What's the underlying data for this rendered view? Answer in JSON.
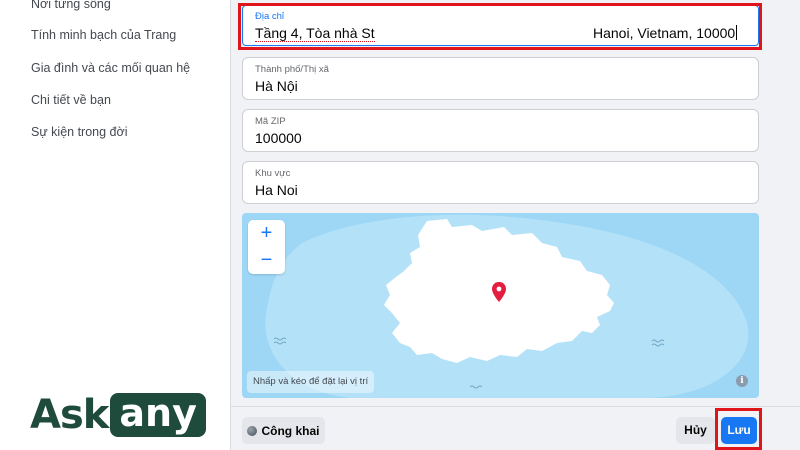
{
  "sidebar": {
    "items": [
      {
        "label": "Nơi từng sống"
      },
      {
        "label": "Tính minh bạch của Trang"
      },
      {
        "label": "Gia đình và các mối quan hệ"
      },
      {
        "label": "Chi tiết về bạn"
      },
      {
        "label": "Sự kiện trong đời"
      }
    ]
  },
  "form": {
    "address": {
      "label": "Địa chỉ",
      "value_start": "Tầng 4, Tòa nhà St",
      "value_end": "Hanoi, Vietnam, 10000"
    },
    "city": {
      "label": "Thành phố/Thị xã",
      "value": "Hà Nội"
    },
    "zip": {
      "label": "Mã ZIP",
      "value": "100000"
    },
    "region": {
      "label": "Khu vực",
      "value": "Ha Noi"
    }
  },
  "map": {
    "zoom_in": "+",
    "zoom_out": "−",
    "hint": "Nhấp và kéo để đặt lại vị trí",
    "info": "i",
    "colors": {
      "water": "#9dd7f5",
      "land": "#ffffff",
      "pin": "#e41e3f"
    }
  },
  "actions": {
    "public": "Công khai",
    "cancel": "Hủy",
    "save": "Lưu"
  },
  "logo": {
    "part1": "Ask",
    "part2": "any"
  },
  "colors": {
    "accent": "#1877f2",
    "highlight": "#e0151c",
    "brand": "#1e4b3c"
  }
}
